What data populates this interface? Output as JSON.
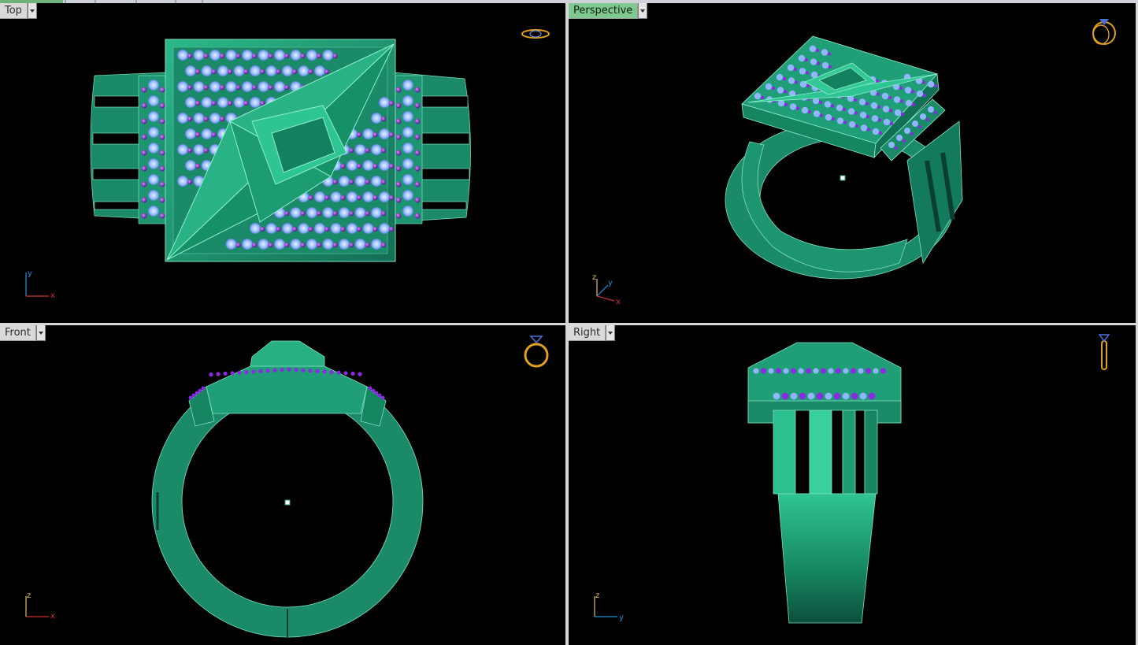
{
  "viewports": {
    "top": {
      "label": "Top",
      "axes": [
        "y",
        "x"
      ]
    },
    "perspective": {
      "label": "Perspective",
      "axes": [
        "z",
        "y",
        "x"
      ]
    },
    "front": {
      "label": "Front",
      "axes": [
        "z",
        "x"
      ]
    },
    "right": {
      "label": "Right",
      "axes": [
        "z",
        "y"
      ]
    }
  },
  "colors": {
    "background": "#000000",
    "metal": "#1f9e78",
    "metal_edge": "#7fe0c0",
    "gem_center": "#8fb6ff",
    "gem_accent": "#8a2be2",
    "axis_x": "#d03030",
    "axis_y": "#2a8fd8",
    "axis_z": "#e0c060",
    "icon": "#e0a020",
    "active_tab": "#7fc88f"
  }
}
